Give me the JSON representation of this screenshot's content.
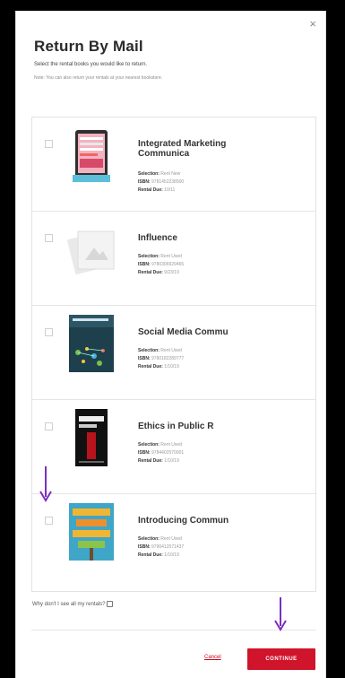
{
  "modal": {
    "close_glyph": "×",
    "title": "Return By Mail",
    "subtitle": "Select the rental books you would like to return.",
    "note": "Note: You can also return your rentals at your nearest bookstore.",
    "why_label": "Why don't I see all my rentals?",
    "cancel_label": "Cancel",
    "continue_label": "CONTINUE"
  },
  "meta_labels": {
    "selection": "Selection:",
    "isbn": "ISBN:",
    "due": "Rental Due:"
  },
  "items": [
    {
      "title": "Integrated Marketing Communica",
      "selection": "Rent New",
      "isbn": "9781452238500",
      "due": "10/11"
    },
    {
      "title": "Influence",
      "selection": "Rent Used",
      "isbn": "9780306929465",
      "due": "9/23/19"
    },
    {
      "title": "Social Media Commu",
      "selection": "Rent Used",
      "isbn": "9780182289777",
      "due": "1/10/19"
    },
    {
      "title": "Ethics in Public R",
      "selection": "Rent Used",
      "isbn": "9784402570001",
      "due": "1/10/19"
    },
    {
      "title": "Introducing Commun",
      "selection": "Rent Used",
      "isbn": "9790412571437",
      "due": "1/10/19"
    }
  ],
  "colors": {
    "accent": "#d0142b",
    "annotation_arrow": "#7b2fbe"
  }
}
